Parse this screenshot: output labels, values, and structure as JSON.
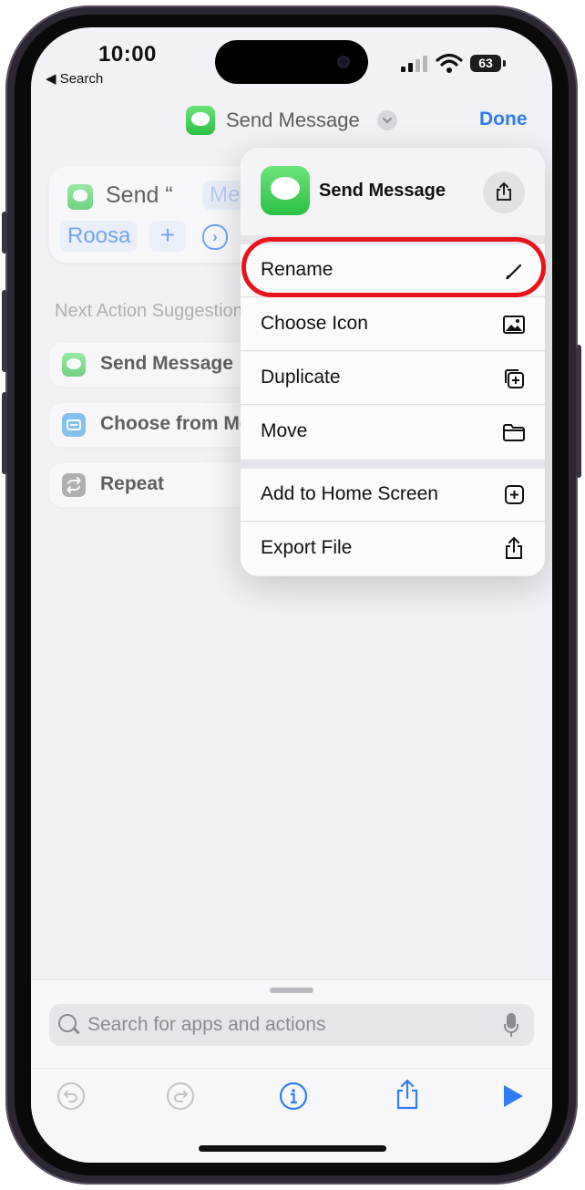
{
  "status_bar": {
    "time": "10:00",
    "back_label": "Search",
    "battery": "63"
  },
  "nav": {
    "title": "Send Message",
    "done_label": "Done"
  },
  "action_card": {
    "send_text": "Send “",
    "placeholder": "Message",
    "recipient": "Roosa",
    "plus": "+",
    "more": "›"
  },
  "suggestions": {
    "heading": "Next Action Suggestions",
    "items": [
      {
        "label": "Send Message",
        "icon": "messages-icon",
        "color": "#34c759"
      },
      {
        "label": "Choose from Menu",
        "icon": "menu-icon",
        "color": "#4aa8e8"
      },
      {
        "label": "Repeat",
        "icon": "repeat-icon",
        "color": "#8e8e93"
      }
    ]
  },
  "menu": {
    "title": "Send Message",
    "items": [
      {
        "label": "Rename",
        "icon": "pencil-icon"
      },
      {
        "label": "Choose Icon",
        "icon": "photo-icon"
      },
      {
        "label": "Duplicate",
        "icon": "duplicate-icon"
      },
      {
        "label": "Move",
        "icon": "folder-icon"
      },
      {
        "label": "Add to Home Screen",
        "icon": "add-square-icon"
      },
      {
        "label": "Export File",
        "icon": "share-icon"
      }
    ]
  },
  "search": {
    "placeholder": "Search for apps and actions"
  },
  "colors": {
    "accent": "#2f7df6",
    "highlight": "#e8141b"
  }
}
